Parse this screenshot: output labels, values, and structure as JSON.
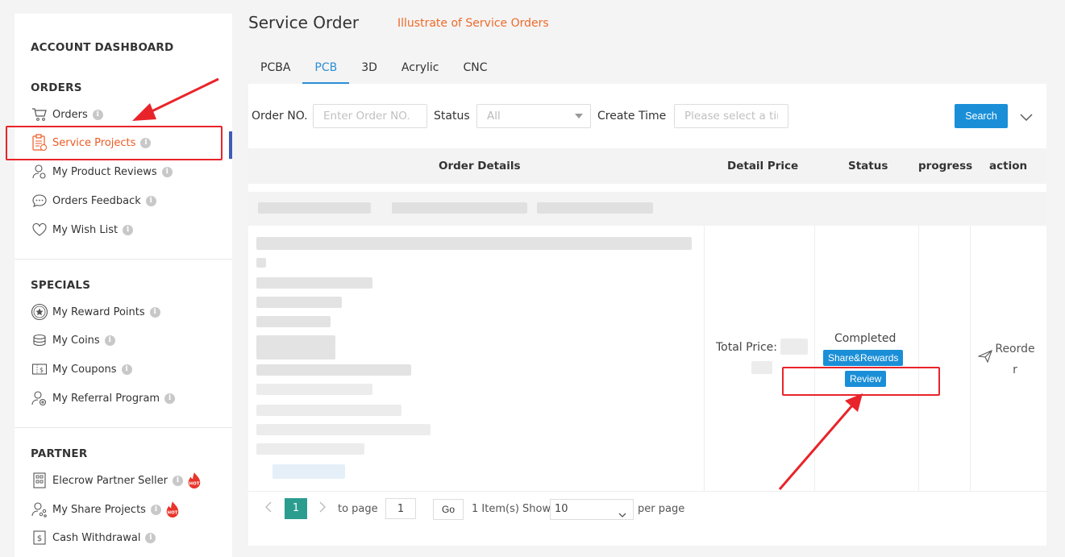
{
  "sidebar": {
    "dashboard_title": "ACCOUNT DASHBOARD",
    "orders_section": {
      "title": "ORDERS",
      "items": [
        {
          "label": "Orders",
          "icon": "cart-icon"
        },
        {
          "label": "Service Projects",
          "icon": "clipboard-icon",
          "active": true
        },
        {
          "label": "My Product Reviews",
          "icon": "user-review-icon"
        },
        {
          "label": "Orders Feedback",
          "icon": "chat-bubble-icon"
        },
        {
          "label": "My Wish List",
          "icon": "heart-icon"
        }
      ]
    },
    "specials_section": {
      "title": "SPECIALS",
      "items": [
        {
          "label": "My Reward Points",
          "icon": "star-badge-icon"
        },
        {
          "label": "My Coins",
          "icon": "coins-icon"
        },
        {
          "label": "My Coupons",
          "icon": "coupon-icon"
        },
        {
          "label": "My Referral Program",
          "icon": "user-add-icon"
        }
      ]
    },
    "partner_section": {
      "title": "PARTNER",
      "items": [
        {
          "label": "Elecrow Partner Seller",
          "icon": "store-icon",
          "hot": true
        },
        {
          "label": "My Share Projects",
          "icon": "share-user-icon",
          "hot": true
        },
        {
          "label": "Cash Withdrawal",
          "icon": "dollar-icon"
        }
      ]
    },
    "hot_label": "HOT",
    "info_glyph": "i"
  },
  "header": {
    "title": "Service Order",
    "illustrate_link": "Illustrate of Service Orders"
  },
  "tabs": [
    "PCBA",
    "PCB",
    "3D",
    "Acrylic",
    "CNC"
  ],
  "active_tab": "PCB",
  "filters": {
    "order_no_label": "Order NO.",
    "order_no_placeholder": "Enter Order NO.",
    "status_label": "Status",
    "status_value": "All",
    "create_time_label": "Create Time",
    "create_time_placeholder": "Please select a time",
    "search_label": "Search"
  },
  "table": {
    "headers": [
      "Order Details",
      "Detail Price",
      "Status",
      "progress",
      "action"
    ],
    "row": {
      "price_label": "Total Price:",
      "status": "Completed",
      "share_button": "Share&Rewards",
      "review_button": "Review",
      "reorder_label": "Reorder"
    }
  },
  "pagination": {
    "current_page": "1",
    "to_page_label": "to page",
    "page_input": "1",
    "go_label": "Go",
    "items_label": "1 Item(s) Show",
    "page_size": "10",
    "per_page_label": "per page"
  },
  "colors": {
    "accent": "#ee5a24",
    "primary_blue": "#1a8fd8",
    "annotation_red": "#e8242a",
    "pager_teal": "#2a9d8f"
  }
}
